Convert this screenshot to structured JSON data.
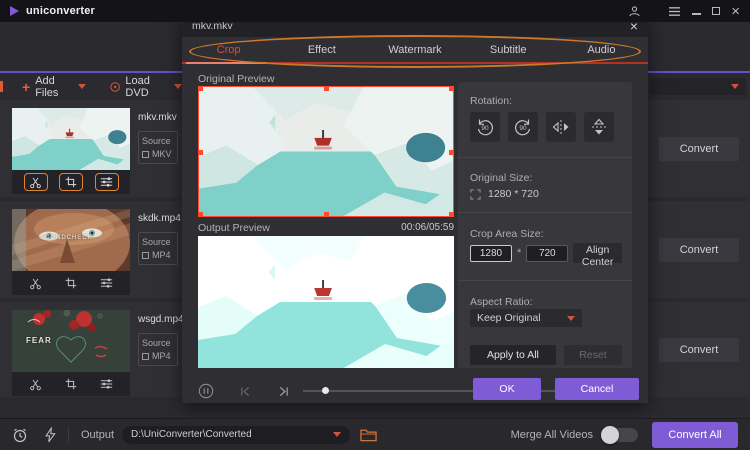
{
  "app": {
    "title": "uniconverter"
  },
  "glyphs": {
    "close": "×"
  },
  "toolbar": {
    "add_files": "Add Files",
    "load_dvd": "Load DVD"
  },
  "files": [
    {
      "name": "mkv.mkv",
      "source_label": "Source",
      "format": "MKV"
    },
    {
      "name": "skdk.mp4",
      "source_label": "Source",
      "format": "MP4",
      "overlay": "SOUNDCHECK"
    },
    {
      "name": "wsgd.mp4",
      "source_label": "Source",
      "format": "MP4",
      "overlay": "FEAR"
    }
  ],
  "convert_label": "Convert",
  "dialog": {
    "title": "mkv.mkv",
    "tabs": [
      {
        "label": "Crop",
        "active": true
      },
      {
        "label": "Effect"
      },
      {
        "label": "Watermark"
      },
      {
        "label": "Subtitle"
      },
      {
        "label": "Audio"
      }
    ],
    "original_preview_label": "Original Preview",
    "output_preview_label": "Output Preview",
    "time": "00:06/05:59",
    "rotation_label": "Rotation:",
    "rotate_ccw_degrees": "90",
    "rotate_cw_degrees": "90",
    "original_size_label": "Original Size:",
    "original_size_value": "1280 * 720",
    "crop_area_label": "Crop Area Size:",
    "crop_width": "1280",
    "crop_separator": "*",
    "crop_height": "720",
    "align_center": "Align Center",
    "aspect_ratio_label": "Aspect Ratio:",
    "aspect_ratio_value": "Keep Original",
    "apply_to_all": "Apply to All",
    "reset": "Reset",
    "ok": "OK",
    "cancel": "Cancel"
  },
  "bottom_bar": {
    "output_label": "Output",
    "output_path": "D:\\UniConverter\\Converted",
    "merge_label": "Merge All Videos",
    "convert_all": "Convert All"
  },
  "colors": {
    "accent_purple": "#7d5cd6",
    "accent_orange": "#e0862e",
    "tab_active": "#d8503a",
    "crop_border": "#ff4a2e"
  }
}
